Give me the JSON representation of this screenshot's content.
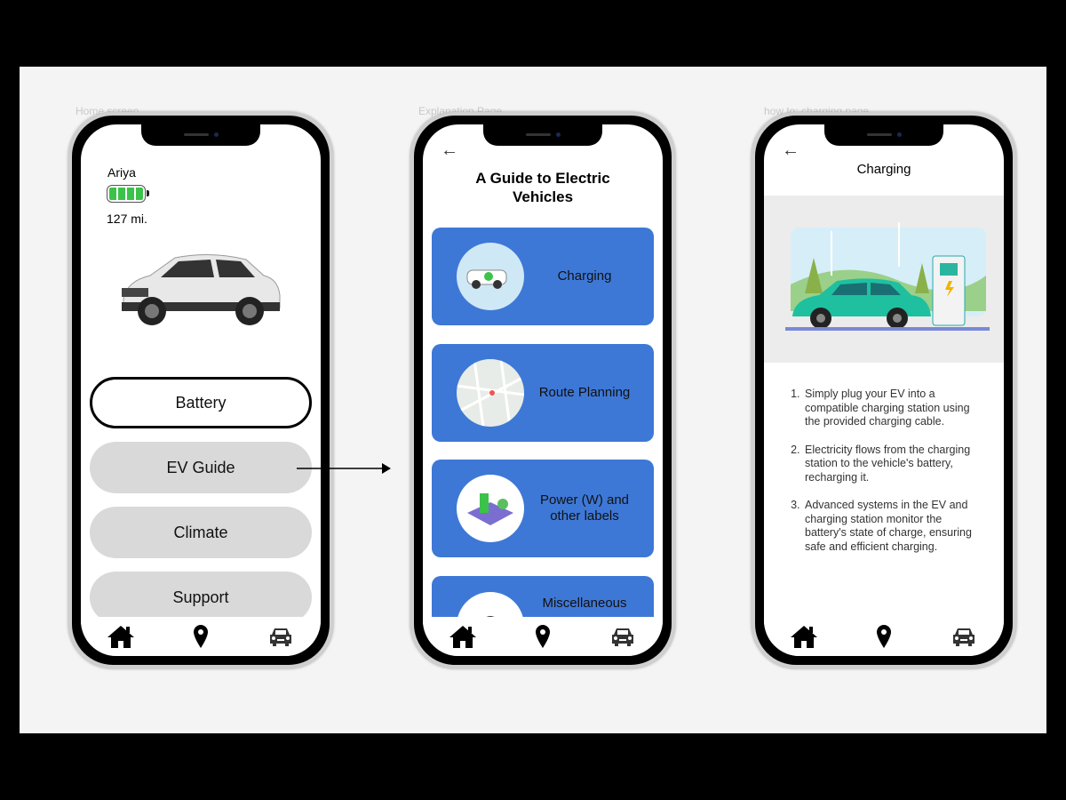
{
  "frames": [
    {
      "label": "Home screen"
    },
    {
      "label": "Explanation Page"
    },
    {
      "label": "how to: charging page"
    }
  ],
  "home": {
    "vehicle_name": "Ariya",
    "battery_level": 1.0,
    "battery_color": "#3cc24a",
    "range": "127 mi.",
    "buttons": [
      {
        "label": "Battery"
      },
      {
        "label": "EV Guide"
      },
      {
        "label": "Climate"
      },
      {
        "label": "Support"
      }
    ]
  },
  "guide": {
    "title": "A Guide to Electric Vehicles",
    "cards": [
      {
        "label": "Charging"
      },
      {
        "label": "Route Planning"
      },
      {
        "label": "Power (W) and other labels"
      },
      {
        "label": "Miscellaneous"
      }
    ],
    "card_color": "#3e78d6"
  },
  "charging": {
    "title": "Charging",
    "steps": [
      "Simply plug your EV into a compatible charging station using the provided charging cable.",
      "Electricity flows from the charging station to the vehicle's battery, recharging it.",
      "Advanced systems in the EV and charging station monitor the battery's state of charge, ensuring safe and efficient charging."
    ]
  },
  "tabbar": {
    "icons": [
      "home-icon",
      "location-pin-icon",
      "car-icon"
    ]
  }
}
